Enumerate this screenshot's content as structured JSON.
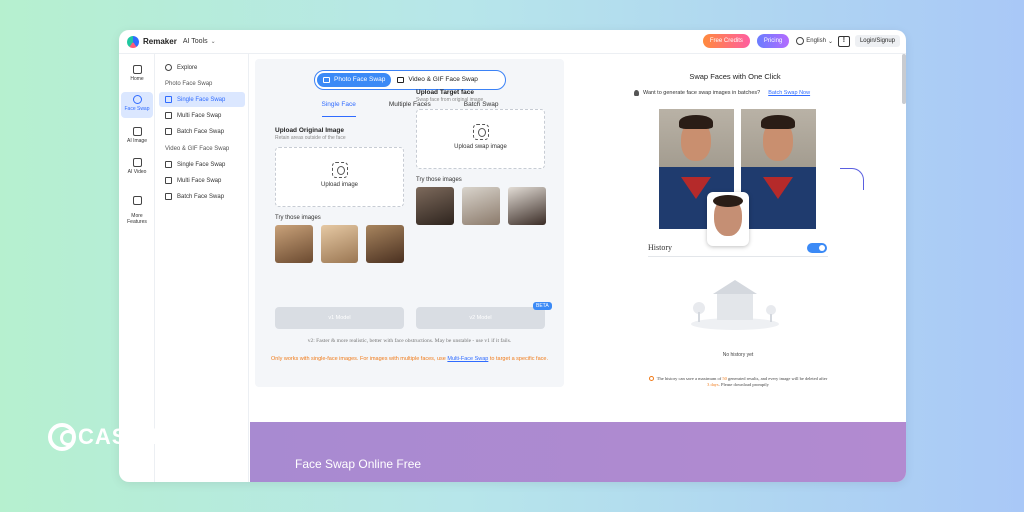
{
  "app": {
    "brand": "Remaker",
    "menu": "AI Tools"
  },
  "topbar": {
    "free_credits": "Free Credits",
    "pricing": "Pricing",
    "language": "English",
    "login": "Login/Signup"
  },
  "rail": [
    {
      "label": "Home",
      "icon": "home-icon"
    },
    {
      "label": "Face Swap",
      "icon": "face-swap-icon"
    },
    {
      "label": "AI Image",
      "icon": "image-icon"
    },
    {
      "label": "AI Video",
      "icon": "video-icon"
    },
    {
      "label": "More\nFeatures",
      "icon": "grid-icon"
    }
  ],
  "subnav": {
    "explore": "Explore",
    "photo_header": "Photo Face Swap",
    "photo_items": [
      "Single Face Swap",
      "Multi Face Swap",
      "Batch Face Swap"
    ],
    "video_header": "Video & GIF Face Swap",
    "video_items": [
      "Single Face Swap",
      "Multi Face Swap",
      "Batch Face Swap"
    ]
  },
  "center": {
    "mode_photo": "Photo Face Swap",
    "mode_video": "Video & GIF Face Swap",
    "tabs": [
      "Single Face",
      "Multiple Faces",
      "Batch Swap"
    ],
    "left_title": "Upload Original Image",
    "left_sub": "Retain areas outside of the face",
    "left_upload": "Upload image",
    "right_title": "Upload Target face",
    "right_sub": "Swap face from original image",
    "right_upload": "Upload swap image",
    "try_label": "Try those images",
    "v1": "v1 Model",
    "v2": "v2 Model",
    "beta": "BETA",
    "note_grey": "v2: Faster & more realistic, better with face obstructions. May be unstable - use v1 if it fails.",
    "note_orange_a": "Only works with single-face images. For images with multiple faces, use",
    "note_orange_link": "Multi-Face Swap",
    "note_orange_b": "to target a specific face."
  },
  "right": {
    "title": "Swap Faces with One Click",
    "prompt": "Want to generate face swap images in batches?",
    "prompt_link": "Batch Swap Now",
    "history": "History",
    "empty": "No history yet",
    "warn_a": "The history can save a maximum of",
    "warn_count": "50",
    "warn_b": "generated results, and every image will be deleted after",
    "warn_days": "3 days",
    "warn_c": ". Please download promptly"
  },
  "banner": {
    "text": "Face Swap Online Free"
  },
  "watermark": {
    "text": "CASHIFY"
  },
  "colors": {
    "accent": "#3b8af6",
    "orange": "#f07b1a",
    "banner": "#a88ad1"
  }
}
